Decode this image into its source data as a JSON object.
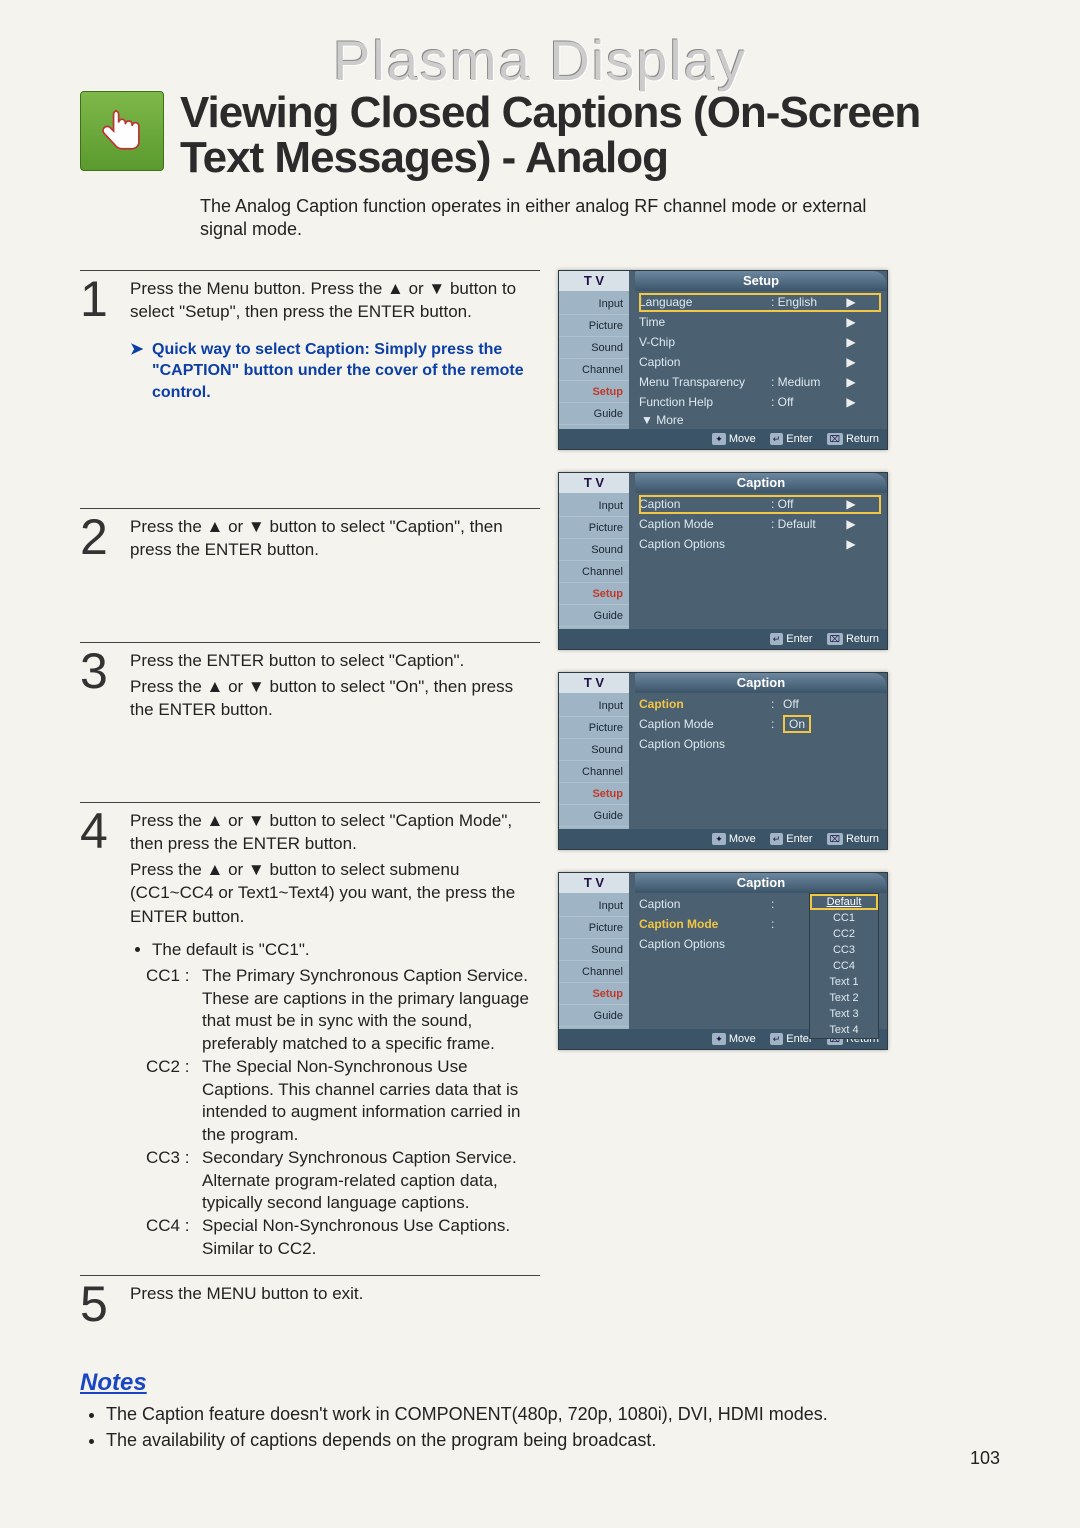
{
  "brand": "Plasma Display",
  "title": "Viewing Closed Captions (On-Screen Text Messages) - Analog",
  "intro": "The Analog Caption function operates in either analog RF channel mode or external signal mode.",
  "steps": [
    {
      "num": "1",
      "text": "Press the Menu button. Press the ▲ or ▼ button to select \"Setup\", then press the ENTER button.",
      "tip": "Quick way to select Caption: Simply press the \"CAPTION\" button under the cover of the remote control."
    },
    {
      "num": "2",
      "text": "Press the ▲ or ▼ button to select \"Caption\", then press the ENTER button."
    },
    {
      "num": "3",
      "text": "Press the ENTER button to select \"Caption\".\nPress the ▲ or ▼ button to select \"On\", then press the ENTER button."
    },
    {
      "num": "4",
      "text": "Press the ▲ or ▼ button to select \"Caption Mode\", then press the ENTER button.\nPress the ▲ or ▼ button to select submenu (CC1~CC4 or Text1~Text4) you want, the press the ENTER button.",
      "bullets": [
        "The default is \"CC1\"."
      ],
      "cc": [
        {
          "code": "CC1 :",
          "desc": "The Primary Synchronous Caption Service. These are captions in the primary language that must be in sync with the sound, preferably matched to a specific frame."
        },
        {
          "code": "CC2 :",
          "desc": "The Special Non-Synchronous Use Captions. This channel carries data that is intended to augment information carried in the program."
        },
        {
          "code": "CC3 :",
          "desc": "Secondary Synchronous Caption Service. Alternate program-related caption data, typically second language captions."
        },
        {
          "code": "CC4 :",
          "desc": "Special Non-Synchronous Use Captions. Similar to CC2."
        }
      ]
    },
    {
      "num": "5",
      "text": "Press the MENU button to exit."
    }
  ],
  "notes": {
    "heading": "Notes",
    "items": [
      "The Caption feature doesn't work in COMPONENT(480p, 720p, 1080i), DVI, HDMI modes.",
      "The availability of captions depends on the program being broadcast."
    ]
  },
  "osd": {
    "tvLabel": "T V",
    "nav": [
      "Input",
      "Picture",
      "Sound",
      "Channel",
      "Setup",
      "Guide"
    ],
    "panel1": {
      "title": "Setup",
      "rows": [
        {
          "label": "Language",
          "value": ": English",
          "arrow": "▶",
          "selected": true
        },
        {
          "label": "Time",
          "value": "",
          "arrow": "▶"
        },
        {
          "label": "V-Chip",
          "value": "",
          "arrow": "▶"
        },
        {
          "label": "Caption",
          "value": "",
          "arrow": "▶"
        },
        {
          "label": "Menu Transparency",
          "value": ": Medium",
          "arrow": "▶"
        },
        {
          "label": "Function Help",
          "value": ": Off",
          "arrow": "▶"
        }
      ],
      "more": "▼ More",
      "hints": [
        "Move",
        "Enter",
        "Return"
      ]
    },
    "panel2": {
      "title": "Caption",
      "rows": [
        {
          "label": "Caption",
          "value": ": Off",
          "arrow": "▶",
          "selected": true
        },
        {
          "label": "Caption Mode",
          "value": ": Default",
          "arrow": "▶"
        },
        {
          "label": "Caption Options",
          "value": "",
          "arrow": "▶"
        }
      ],
      "hints": [
        "Enter",
        "Return"
      ]
    },
    "panel3": {
      "title": "Caption",
      "rows": [
        {
          "label": "Caption",
          "labelHl": true,
          "value": "Off",
          "colon": ":"
        },
        {
          "label": "Caption Mode",
          "value": "On",
          "colon": ":",
          "valueHl": true
        },
        {
          "label": "Caption Options",
          "value": ""
        }
      ],
      "hints": [
        "Move",
        "Enter",
        "Return"
      ]
    },
    "panel4": {
      "title": "Caption",
      "rows": [
        {
          "label": "Caption",
          "value": "",
          "colon": ":"
        },
        {
          "label": "Caption Mode",
          "labelHl": true,
          "value": "",
          "colon": ":"
        },
        {
          "label": "Caption Options",
          "value": ""
        }
      ],
      "submenu": [
        "Default",
        "CC1",
        "CC2",
        "CC3",
        "CC4",
        "Text 1",
        "Text 2",
        "Text 3",
        "Text 4"
      ],
      "submenuSelected": 0,
      "hints": [
        "Move",
        "Enter",
        "Return"
      ]
    }
  },
  "pageNumber": "103"
}
